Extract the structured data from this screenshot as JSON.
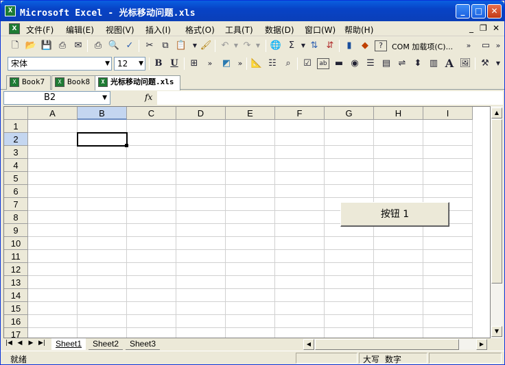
{
  "window": {
    "title": "Microsoft Excel - 光标移动问题.xls",
    "app_icon": "excel-icon",
    "buttons": {
      "minimize": "_",
      "maximize": "□",
      "close": "✕"
    }
  },
  "menubar": {
    "items": [
      {
        "label": "文件(F)"
      },
      {
        "label": "编辑(E)"
      },
      {
        "label": "视图(V)"
      },
      {
        "label": "插入(I)"
      },
      {
        "label": "格式(O)"
      },
      {
        "label": "工具(T)"
      },
      {
        "label": "数据(D)"
      },
      {
        "label": "窗口(W)"
      },
      {
        "label": "帮助(H)"
      }
    ],
    "window_controls": {
      "minimize": "_",
      "restore": "❐",
      "close": "✕"
    }
  },
  "standard_toolbar": {
    "icons": [
      "new-icon",
      "open-icon",
      "save-icon",
      "permission-icon",
      "email-icon",
      "print-icon",
      "print-preview-icon",
      "spelling-icon",
      "cut-icon",
      "copy-icon",
      "paste-icon",
      "format-painter-icon",
      "undo-icon",
      "redo-icon",
      "hyperlink-icon",
      "autosum-icon",
      "sort-ascending-icon",
      "sort-descending-icon",
      "chart-wizard-icon",
      "drawing-icon",
      "help-icon"
    ],
    "com_label": "COM 加载项(C)..."
  },
  "formatting_toolbar": {
    "font_name": "宋体",
    "font_size": "12",
    "bold": "B",
    "underline": "U"
  },
  "doc_tabs": [
    {
      "label": "Book7"
    },
    {
      "label": "Book8"
    },
    {
      "label": "光标移动问题.xls",
      "active": true
    }
  ],
  "formula_bar": {
    "name_box": "B2",
    "fx_label": "fx",
    "formula": ""
  },
  "sheet": {
    "columns": [
      "A",
      "B",
      "C",
      "D",
      "E",
      "F",
      "G",
      "H",
      "I"
    ],
    "rows": [
      "1",
      "2",
      "3",
      "4",
      "5",
      "6",
      "7",
      "8",
      "9",
      "10",
      "11",
      "12",
      "13",
      "14",
      "15",
      "16",
      "17"
    ],
    "selected_column": "B",
    "selected_row": "2",
    "active_cell": "B2"
  },
  "form_button": {
    "label": "按钮 1"
  },
  "sheet_tabs": [
    {
      "label": "Sheet1",
      "active": true
    },
    {
      "label": "Sheet2"
    },
    {
      "label": "Sheet3"
    }
  ],
  "statusbar": {
    "left": "就绪",
    "caps": "大写",
    "num": "数字"
  }
}
